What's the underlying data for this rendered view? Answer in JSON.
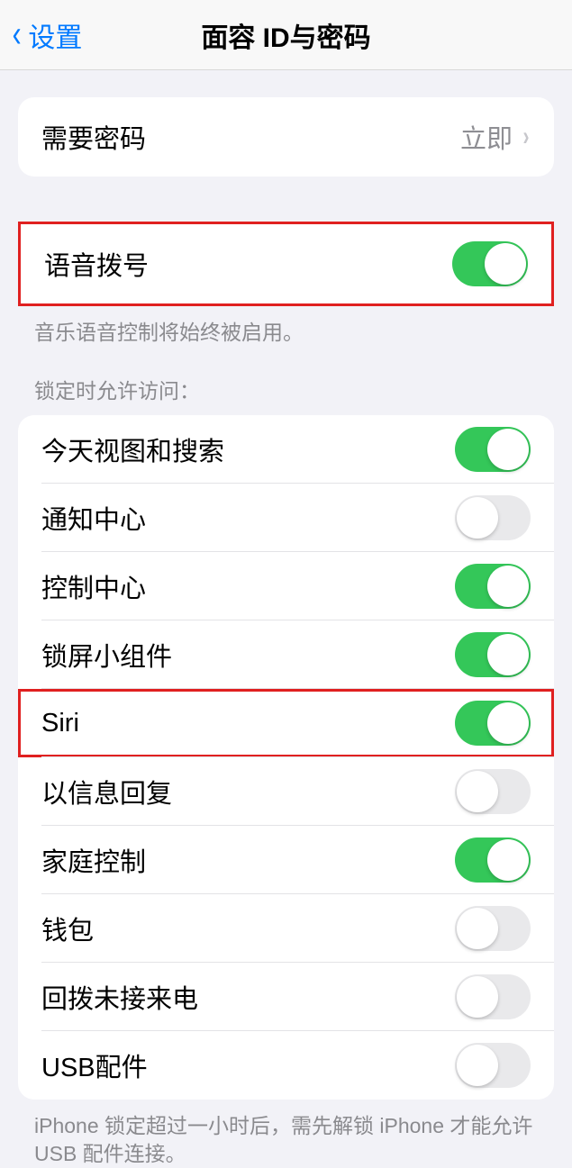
{
  "nav": {
    "back_label": "设置",
    "title": "面容 ID与密码"
  },
  "passcode_row": {
    "label": "需要密码",
    "value": "立即"
  },
  "voice_dial": {
    "label": "语音拨号",
    "footer": "音乐语音控制将始终被启用。"
  },
  "lock_section": {
    "header": "锁定时允许访问：",
    "items": [
      {
        "label": "今天视图和搜索",
        "on": true,
        "highlight": false
      },
      {
        "label": "通知中心",
        "on": false,
        "highlight": false
      },
      {
        "label": "控制中心",
        "on": true,
        "highlight": false
      },
      {
        "label": "锁屏小组件",
        "on": true,
        "highlight": false
      },
      {
        "label": "Siri",
        "on": true,
        "highlight": true
      },
      {
        "label": "以信息回复",
        "on": false,
        "highlight": false
      },
      {
        "label": "家庭控制",
        "on": true,
        "highlight": false
      },
      {
        "label": "钱包",
        "on": false,
        "highlight": false
      },
      {
        "label": "回拨未接来电",
        "on": false,
        "highlight": false
      },
      {
        "label": "USB配件",
        "on": false,
        "highlight": false
      }
    ],
    "footer": "iPhone 锁定超过一小时后，需先解锁 iPhone 才能允许 USB 配件连接。"
  }
}
